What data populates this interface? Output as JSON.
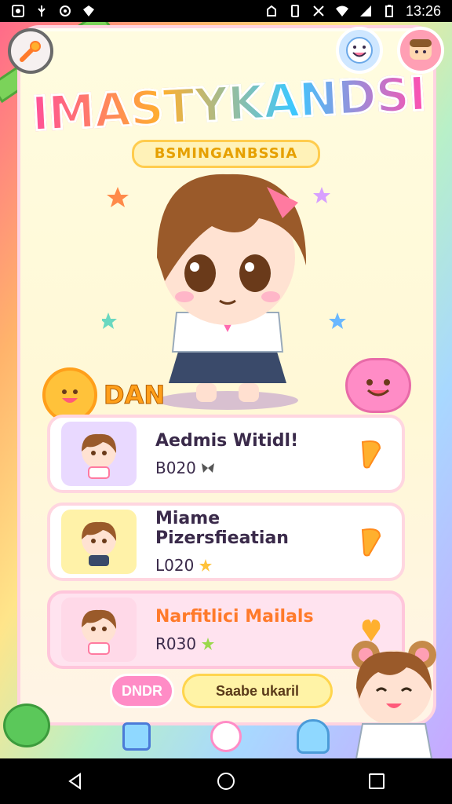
{
  "status_bar": {
    "left_icons": [
      "notification-icon",
      "usb-icon",
      "sync-icon",
      "shield-icon"
    ],
    "right_icons": [
      "alarm-icon",
      "vibrate-icon",
      "no-signal-icon",
      "wifi-icon",
      "signal-icon",
      "battery-icon"
    ],
    "time": "13:26"
  },
  "header": {
    "title": "IMASTYKANDSI",
    "subtitle": "BSMINGANBSSIA"
  },
  "hero": {
    "name": "DAN"
  },
  "cards": [
    {
      "title": "Aedmis Witidl!",
      "code": "B020",
      "badge_icon": "butterfly-icon"
    },
    {
      "title": "Miame Pizersfieatian",
      "code": "L020",
      "badge_icon": "star-icon"
    },
    {
      "title": "Narfitlici Mailals",
      "code": "R030",
      "badge_icon": "star-icon"
    }
  ],
  "actions": {
    "left_label": "DNDR",
    "right_label": "Saabe ukaril"
  },
  "colors": {
    "accent_pink": "#ff8cc6",
    "accent_yellow": "#ffd54d",
    "panel": "#fffce0"
  }
}
